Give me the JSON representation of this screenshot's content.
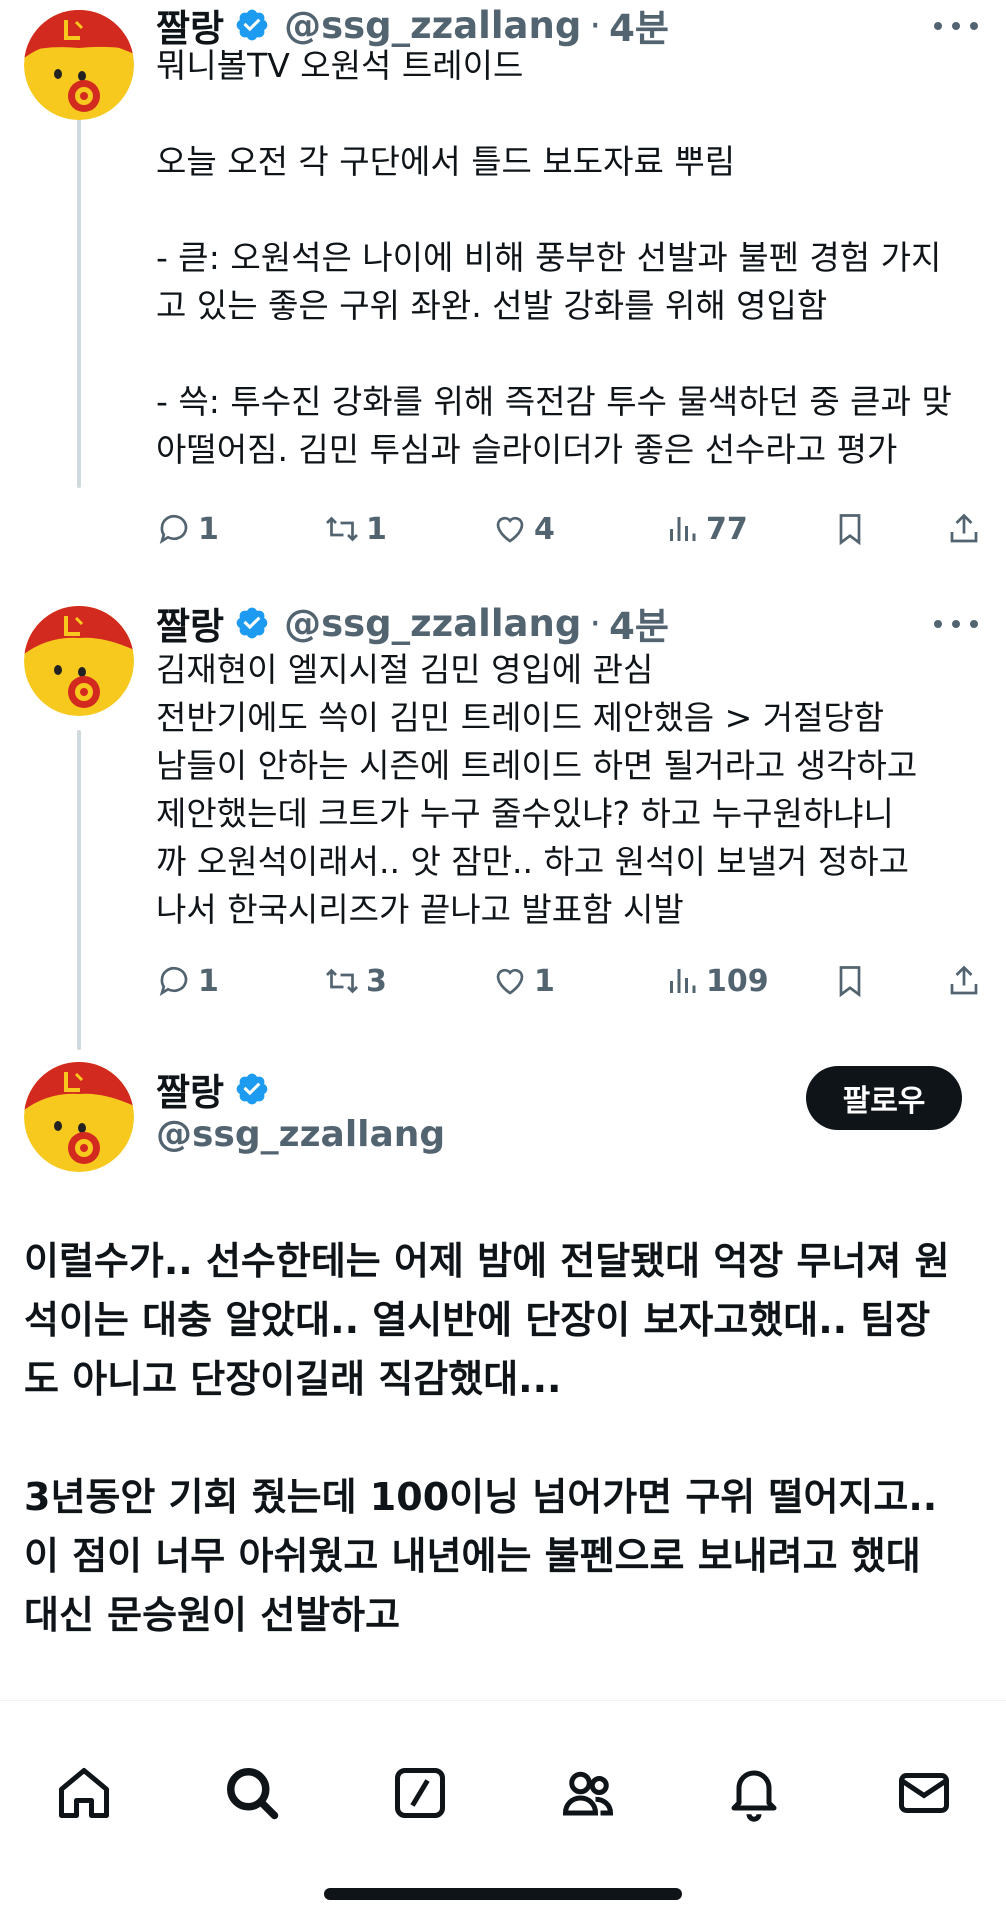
{
  "colors": {
    "text": "#0f1419",
    "secondary": "#536471",
    "verified": "#1d9bf0",
    "thread_line": "#cfd9de",
    "follow_bg": "#0f1419"
  },
  "tweets": [
    {
      "name": "짤랑",
      "handle": "@ssg_zzallang",
      "dot": "·",
      "time": "4분",
      "text": "뭐니볼TV 오원석 트레이드\n\n오늘 오전 각 구단에서 틀드 보도자료 뿌림\n\n- 큳: 오원석은 나이에 비해 풍부한 선발과 불펜 경험 가지\n고 있는 좋은 구위 좌완. 선발 강화를 위해 영입함\n\n- 쓱: 투수진 강화를 위해 즉전감 투수 물색하던 중 큳과 맞\n아떨어짐. 김민 투심과 슬라이더가 좋은 선수라고 평가",
      "replies": "1",
      "retweets": "1",
      "likes": "4",
      "views": "77"
    },
    {
      "name": "짤랑",
      "handle": "@ssg_zzallang",
      "dot": "·",
      "time": "4분",
      "text": "김재현이 엘지시절 김민 영입에 관심\n전반기에도 쓱이 김민 트레이드 제안했음 > 거절당함\n남들이 안하는 시즌에 트레이드 하면 될거라고 생각하고\n제안했는데 크트가 누구 줄수있냐? 하고 누구원하냐니\n까 오원석이래서.. 앗 잠만.. 하고 원석이 보낼거 정하고\n나서 한국시리즈가 끝나고 발표함 시발",
      "replies": "1",
      "retweets": "3",
      "likes": "1",
      "views": "109"
    }
  ],
  "main_tweet": {
    "name": "짤랑",
    "handle": "@ssg_zzallang",
    "follow_label": "팔로우",
    "text": "이럴수가.. 선수한테는 어제 밤에 전달됐대 억장 무너져 원\n석이는 대충 알았대.. 열시반에 단장이 보자고했대.. 팀장\n도 아니고 단장이길래 직감했대...\n\n3년동안 기회 줬는데 100이닝 넘어가면 구위 떨어지고..\n이 점이 너무 아쉬웠고 내년에는 불펜으로 보내려고 했대\n대신 문승원이 선발하고"
  },
  "bottom_nav": {
    "items": [
      "home-icon",
      "search-icon",
      "grok-icon",
      "communities-icon",
      "notifications-icon",
      "messages-icon"
    ]
  }
}
